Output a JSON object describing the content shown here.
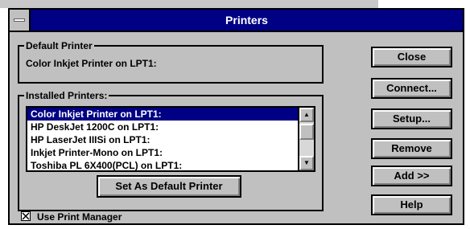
{
  "window": {
    "title": "Printers"
  },
  "default_printer": {
    "label": "Default Printer",
    "value": "Color Inkjet Printer on LPT1:"
  },
  "installed": {
    "label": "Installed Printers:",
    "items": [
      "Color Inkjet Printer on LPT1:",
      "HP DeskJet 1200C on LPT1:",
      "HP LaserJet IIISi on LPT1:",
      "Inkjet Printer-Mono on LPT1:",
      "Toshiba PL 6X400(PCL) on LPT1:"
    ],
    "selected_index": 0
  },
  "buttons": {
    "set_default": "Set As Default Printer",
    "close": "Close",
    "connect": "Connect...",
    "setup": "Setup...",
    "remove": "Remove",
    "add": "Add >>",
    "help": "Help"
  },
  "print_manager": {
    "label": "Use Print Manager",
    "checked": true
  },
  "icons": {
    "system_menu": "system-menu-icon",
    "scroll_up": "up-arrow-icon",
    "scroll_down": "down-arrow-icon",
    "checkbox": "checkmark-x-icon"
  },
  "colors": {
    "title_bar": "#000084",
    "selection": "#000084",
    "dialog_face": "#c0c0c0"
  }
}
